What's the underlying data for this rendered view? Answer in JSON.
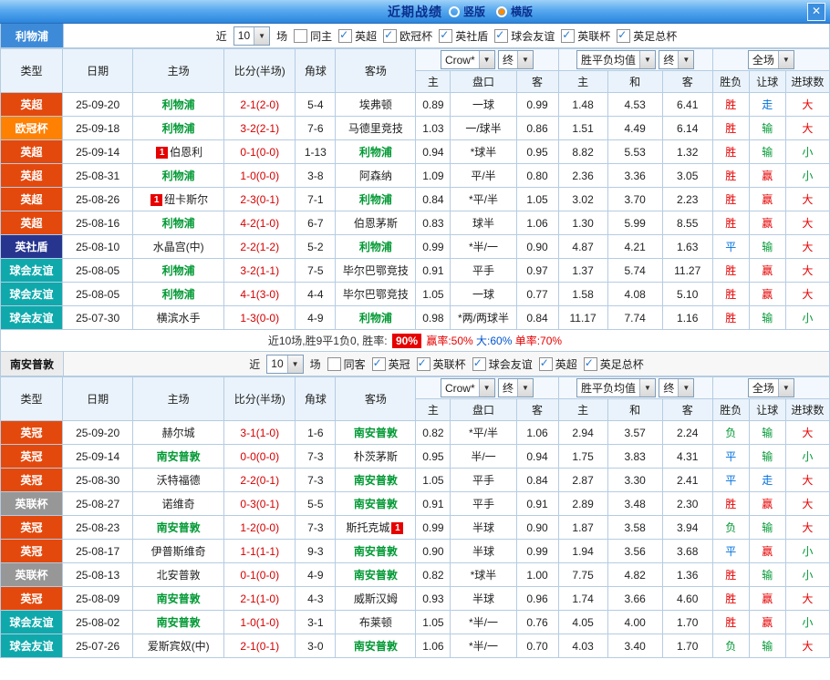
{
  "titlebar": {
    "title": "近期战绩",
    "options": [
      {
        "label": "竖版",
        "selected": false
      },
      {
        "label": "横版",
        "selected": true
      }
    ],
    "close": "✕"
  },
  "table_header": {
    "type": "类型",
    "date": "日期",
    "home": "主场",
    "score": "比分(半场)",
    "corner": "角球",
    "away": "客场",
    "asian_sub": [
      "主",
      "盘口",
      "客"
    ],
    "euro_sub": [
      "主",
      "和",
      "客"
    ],
    "result": "胜负",
    "handicap": "让球",
    "goals": "进球数",
    "selects": {
      "company": "Crow*",
      "final_a": "终",
      "euro_avg": "胜平负均值",
      "final_b": "终",
      "scope": "全场"
    }
  },
  "colors": {
    "competitions": {
      "英超": "#e3490d",
      "欧冠杯": "#ff8103",
      "英社盾": "#27358f",
      "球会友谊": "#0fa9ac",
      "英冠": "#e3490d",
      "英联杯": "#979797"
    },
    "marks": {
      "胜": "#e60000",
      "平": "#0070dd",
      "负": "#019934",
      "赢": "#e60000",
      "走": "#0070dd",
      "输": "#019934",
      "大": "#e60000",
      "小": "#019934"
    }
  },
  "sections": [
    {
      "team": "利物浦",
      "team_style": "blue",
      "filters": {
        "recent": "近",
        "count": "10",
        "matches": "场",
        "items": [
          {
            "label": "同主",
            "checked": false
          },
          {
            "label": "英超",
            "checked": true
          },
          {
            "label": "欧冠杯",
            "checked": true
          },
          {
            "label": "英社盾",
            "checked": true
          },
          {
            "label": "球会友谊",
            "checked": true
          },
          {
            "label": "英联杯",
            "checked": true
          },
          {
            "label": "英足总杯",
            "checked": true
          }
        ]
      },
      "rows": [
        {
          "type": "英超",
          "date": "25-09-20",
          "home": "利物浦",
          "home_subject": true,
          "home_card": "",
          "score": "2-1(2-0)",
          "corner": "5-4",
          "away": "埃弗顿",
          "away_subject": false,
          "away_card": "",
          "asian": [
            "0.89",
            "一球",
            "0.99"
          ],
          "euro": [
            "1.48",
            "4.53",
            "6.41"
          ],
          "result": "胜",
          "handicap": "走",
          "goals": "大"
        },
        {
          "type": "欧冠杯",
          "date": "25-09-18",
          "home": "利物浦",
          "home_subject": true,
          "home_card": "",
          "score": "3-2(2-1)",
          "corner": "7-6",
          "away": "马德里竞技",
          "away_subject": false,
          "away_card": "",
          "asian": [
            "1.03",
            "一/球半",
            "0.86"
          ],
          "euro": [
            "1.51",
            "4.49",
            "6.14"
          ],
          "result": "胜",
          "handicap": "输",
          "goals": "大"
        },
        {
          "type": "英超",
          "date": "25-09-14",
          "home": "伯恩利",
          "home_subject": false,
          "home_card": "1",
          "score": "0-1(0-0)",
          "corner": "1-13",
          "away": "利物浦",
          "away_subject": true,
          "away_card": "",
          "asian": [
            "0.94",
            "*球半",
            "0.95"
          ],
          "euro": [
            "8.82",
            "5.53",
            "1.32"
          ],
          "result": "胜",
          "handicap": "输",
          "goals": "小"
        },
        {
          "type": "英超",
          "date": "25-08-31",
          "home": "利物浦",
          "home_subject": true,
          "home_card": "",
          "score": "1-0(0-0)",
          "corner": "3-8",
          "away": "阿森纳",
          "away_subject": false,
          "away_card": "",
          "asian": [
            "1.09",
            "平/半",
            "0.80"
          ],
          "euro": [
            "2.36",
            "3.36",
            "3.05"
          ],
          "result": "胜",
          "handicap": "赢",
          "goals": "小"
        },
        {
          "type": "英超",
          "date": "25-08-26",
          "home": "纽卡斯尔",
          "home_subject": false,
          "home_card": "1",
          "score": "2-3(0-1)",
          "corner": "7-1",
          "away": "利物浦",
          "away_subject": true,
          "away_card": "",
          "asian": [
            "0.84",
            "*平/半",
            "1.05"
          ],
          "euro": [
            "3.02",
            "3.70",
            "2.23"
          ],
          "result": "胜",
          "handicap": "赢",
          "goals": "大"
        },
        {
          "type": "英超",
          "date": "25-08-16",
          "home": "利物浦",
          "home_subject": true,
          "home_card": "",
          "score": "4-2(1-0)",
          "corner": "6-7",
          "away": "伯恩茅斯",
          "away_subject": false,
          "away_card": "",
          "asian": [
            "0.83",
            "球半",
            "1.06"
          ],
          "euro": [
            "1.30",
            "5.99",
            "8.55"
          ],
          "result": "胜",
          "handicap": "赢",
          "goals": "大"
        },
        {
          "type": "英社盾",
          "date": "25-08-10",
          "home": "水晶宫(中)",
          "home_subject": false,
          "home_card": "",
          "score": "2-2(1-2)",
          "corner": "5-2",
          "away": "利物浦",
          "away_subject": true,
          "away_card": "",
          "asian": [
            "0.99",
            "*半/一",
            "0.90"
          ],
          "euro": [
            "4.87",
            "4.21",
            "1.63"
          ],
          "result": "平",
          "handicap": "输",
          "goals": "大"
        },
        {
          "type": "球会友谊",
          "date": "25-08-05",
          "home": "利物浦",
          "home_subject": true,
          "home_card": "",
          "score": "3-2(1-1)",
          "corner": "7-5",
          "away": "毕尔巴鄂竞技",
          "away_subject": false,
          "away_card": "",
          "asian": [
            "0.91",
            "平手",
            "0.97"
          ],
          "euro": [
            "1.37",
            "5.74",
            "11.27"
          ],
          "result": "胜",
          "handicap": "赢",
          "goals": "大"
        },
        {
          "type": "球会友谊",
          "date": "25-08-05",
          "home": "利物浦",
          "home_subject": true,
          "home_card": "",
          "score": "4-1(3-0)",
          "corner": "4-4",
          "away": "毕尔巴鄂竞技",
          "away_subject": false,
          "away_card": "",
          "asian": [
            "1.05",
            "一球",
            "0.77"
          ],
          "euro": [
            "1.58",
            "4.08",
            "5.10"
          ],
          "result": "胜",
          "handicap": "赢",
          "goals": "大"
        },
        {
          "type": "球会友谊",
          "date": "25-07-30",
          "home": "横滨水手",
          "home_subject": false,
          "home_card": "",
          "score": "1-3(0-0)",
          "corner": "4-9",
          "away": "利物浦",
          "away_subject": true,
          "away_card": "",
          "asian": [
            "0.98",
            "*两/两球半",
            "0.84"
          ],
          "euro": [
            "11.17",
            "7.74",
            "1.16"
          ],
          "result": "胜",
          "handicap": "输",
          "goals": "小"
        }
      ],
      "summary": [
        {
          "text": "近10场,胜9平1负0, 胜率: ",
          "style": "plain"
        },
        {
          "text": "90%",
          "style": "badge"
        },
        {
          "text": " 赢率:50% ",
          "style": "red"
        },
        {
          "text": "大:60% ",
          "style": "blue"
        },
        {
          "text": "单率:70%",
          "style": "red"
        }
      ]
    },
    {
      "team": "南安普敦",
      "team_style": "gray",
      "filters": {
        "recent": "近",
        "count": "10",
        "matches": "场",
        "items": [
          {
            "label": "同客",
            "checked": false
          },
          {
            "label": "英冠",
            "checked": true
          },
          {
            "label": "英联杯",
            "checked": true
          },
          {
            "label": "球会友谊",
            "checked": true
          },
          {
            "label": "英超",
            "checked": true
          },
          {
            "label": "英足总杯",
            "checked": true
          }
        ]
      },
      "rows": [
        {
          "type": "英冠",
          "date": "25-09-20",
          "home": "赫尔城",
          "home_subject": false,
          "home_card": "",
          "score": "3-1(1-0)",
          "corner": "1-6",
          "away": "南安普敦",
          "away_subject": true,
          "away_card": "",
          "asian": [
            "0.82",
            "*平/半",
            "1.06"
          ],
          "euro": [
            "2.94",
            "3.57",
            "2.24"
          ],
          "result": "负",
          "handicap": "输",
          "goals": "大"
        },
        {
          "type": "英冠",
          "date": "25-09-14",
          "home": "南安普敦",
          "home_subject": true,
          "home_card": "",
          "score": "0-0(0-0)",
          "corner": "7-3",
          "away": "朴茨茅斯",
          "away_subject": false,
          "away_card": "",
          "asian": [
            "0.95",
            "半/一",
            "0.94"
          ],
          "euro": [
            "1.75",
            "3.83",
            "4.31"
          ],
          "result": "平",
          "handicap": "输",
          "goals": "小"
        },
        {
          "type": "英冠",
          "date": "25-08-30",
          "home": "沃特福德",
          "home_subject": false,
          "home_card": "",
          "score": "2-2(0-1)",
          "corner": "7-3",
          "away": "南安普敦",
          "away_subject": true,
          "away_card": "",
          "asian": [
            "1.05",
            "平手",
            "0.84"
          ],
          "euro": [
            "2.87",
            "3.30",
            "2.41"
          ],
          "result": "平",
          "handicap": "走",
          "goals": "大"
        },
        {
          "type": "英联杯",
          "date": "25-08-27",
          "home": "诺维奇",
          "home_subject": false,
          "home_card": "",
          "score": "0-3(0-1)",
          "corner": "5-5",
          "away": "南安普敦",
          "away_subject": true,
          "away_card": "",
          "asian": [
            "0.91",
            "平手",
            "0.91"
          ],
          "euro": [
            "2.89",
            "3.48",
            "2.30"
          ],
          "result": "胜",
          "handicap": "赢",
          "goals": "大"
        },
        {
          "type": "英冠",
          "date": "25-08-23",
          "home": "南安普敦",
          "home_subject": true,
          "home_card": "",
          "score": "1-2(0-0)",
          "corner": "7-3",
          "away": "斯托克城",
          "away_subject": false,
          "away_card": "1",
          "asian": [
            "0.99",
            "半球",
            "0.90"
          ],
          "euro": [
            "1.87",
            "3.58",
            "3.94"
          ],
          "result": "负",
          "handicap": "输",
          "goals": "大"
        },
        {
          "type": "英冠",
          "date": "25-08-17",
          "home": "伊普斯维奇",
          "home_subject": false,
          "home_card": "",
          "score": "1-1(1-1)",
          "corner": "9-3",
          "away": "南安普敦",
          "away_subject": true,
          "away_card": "",
          "asian": [
            "0.90",
            "半球",
            "0.99"
          ],
          "euro": [
            "1.94",
            "3.56",
            "3.68"
          ],
          "result": "平",
          "handicap": "赢",
          "goals": "小"
        },
        {
          "type": "英联杯",
          "date": "25-08-13",
          "home": "北安普敦",
          "home_subject": false,
          "home_card": "",
          "score": "0-1(0-0)",
          "corner": "4-9",
          "away": "南安普敦",
          "away_subject": true,
          "away_card": "",
          "asian": [
            "0.82",
            "*球半",
            "1.00"
          ],
          "euro": [
            "7.75",
            "4.82",
            "1.36"
          ],
          "result": "胜",
          "handicap": "输",
          "goals": "小"
        },
        {
          "type": "英冠",
          "date": "25-08-09",
          "home": "南安普敦",
          "home_subject": true,
          "home_card": "",
          "score": "2-1(1-0)",
          "corner": "4-3",
          "away": "威斯汉姆",
          "away_subject": false,
          "away_card": "",
          "asian": [
            "0.93",
            "半球",
            "0.96"
          ],
          "euro": [
            "1.74",
            "3.66",
            "4.60"
          ],
          "result": "胜",
          "handicap": "赢",
          "goals": "大"
        },
        {
          "type": "球会友谊",
          "date": "25-08-02",
          "home": "南安普敦",
          "home_subject": true,
          "home_card": "",
          "score": "1-0(1-0)",
          "corner": "3-1",
          "away": "布莱顿",
          "away_subject": false,
          "away_card": "",
          "asian": [
            "1.05",
            "*半/一",
            "0.76"
          ],
          "euro": [
            "4.05",
            "4.00",
            "1.70"
          ],
          "result": "胜",
          "handicap": "赢",
          "goals": "小"
        },
        {
          "type": "球会友谊",
          "date": "25-07-26",
          "home": "爱斯宾奴(中)",
          "home_subject": false,
          "home_card": "",
          "score": "2-1(0-1)",
          "corner": "3-0",
          "away": "南安普敦",
          "away_subject": true,
          "away_card": "",
          "asian": [
            "1.06",
            "*半/一",
            "0.70"
          ],
          "euro": [
            "4.03",
            "3.40",
            "1.70"
          ],
          "result": "负",
          "handicap": "输",
          "goals": "大"
        }
      ]
    }
  ]
}
